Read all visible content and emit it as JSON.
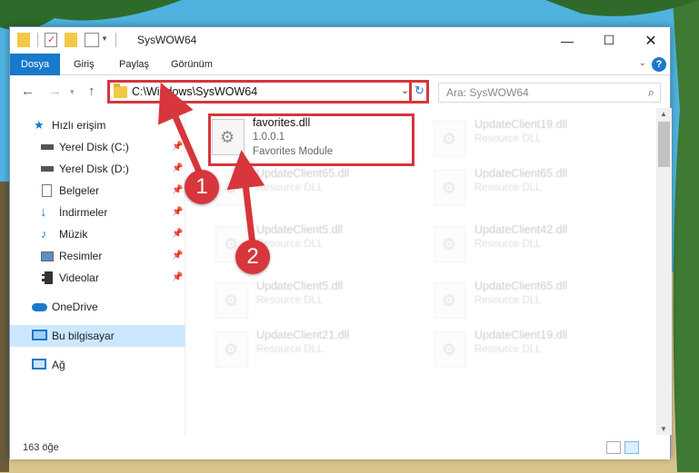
{
  "window": {
    "title": "SysWOW64"
  },
  "ribbon": {
    "tabs": [
      "Dosya",
      "Giriş",
      "Paylaş",
      "Görünüm"
    ]
  },
  "address": {
    "path": "C:\\Windows\\SysWOW64",
    "search_placeholder": "Ara: SysWOW64"
  },
  "sidebar": {
    "items": [
      {
        "label": "Hızlı erişim",
        "icon": "star-icon"
      },
      {
        "label": "Yerel Disk (C:)",
        "icon": "drive-icon",
        "pinned": true
      },
      {
        "label": "Yerel Disk (D:)",
        "icon": "drive-icon",
        "pinned": true
      },
      {
        "label": "Belgeler",
        "icon": "documents-icon",
        "pinned": true
      },
      {
        "label": "İndirmeler",
        "icon": "download-icon",
        "pinned": true
      },
      {
        "label": "Müzik",
        "icon": "music-icon",
        "pinned": true
      },
      {
        "label": "Resimler",
        "icon": "pictures-icon",
        "pinned": true
      },
      {
        "label": "Videolar",
        "icon": "video-icon",
        "pinned": true
      },
      {
        "label": "OneDrive",
        "icon": "cloud-icon"
      },
      {
        "label": "Bu bilgisayar",
        "icon": "computer-icon",
        "selected": true
      },
      {
        "label": "Ağ",
        "icon": "network-icon"
      }
    ]
  },
  "files": {
    "highlighted": {
      "name": "favorites.dll",
      "version": "1.0.0.1",
      "description": "Favorites Module"
    },
    "left_column": [
      {
        "name": "UpdateClient65.dll",
        "description": "Resource DLL"
      },
      {
        "name": "UpdateClient5.dll",
        "description": "Resource DLL"
      },
      {
        "name": "UpdateClient5.dll",
        "description": "Resource DLL"
      },
      {
        "name": "UpdateClient21.dll",
        "description": "Resource DLL"
      }
    ],
    "right_column": [
      {
        "name": "UpdateClient19.dll",
        "description": "Resource DLL"
      },
      {
        "name": "UpdateClient65.dll",
        "description": "Resource DLL"
      },
      {
        "name": "UpdateClient42.dll",
        "description": "Resource DLL"
      },
      {
        "name": "UpdateClient65.dll",
        "description": "Resource DLL"
      },
      {
        "name": "UpdateClient19.dll",
        "description": "Resource DLL"
      }
    ]
  },
  "status": {
    "item_count": "163 öğe"
  },
  "annotations": {
    "badge1": "1",
    "badge2": "2"
  },
  "colors": {
    "accent": "#1979ca",
    "annotation_red": "#d6363c",
    "selection": "#cce8ff"
  }
}
